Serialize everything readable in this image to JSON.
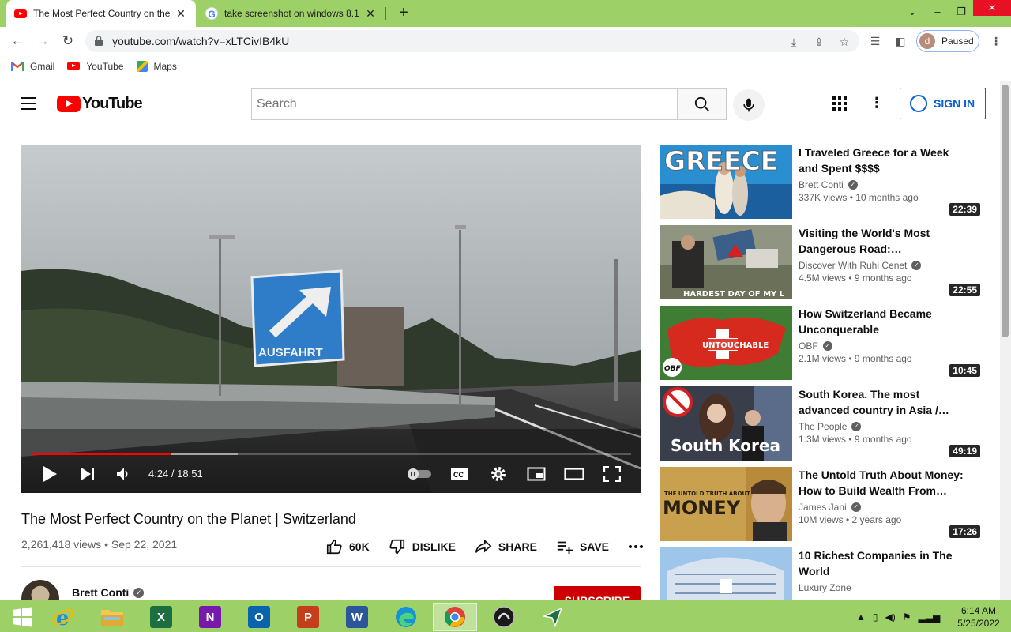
{
  "browser": {
    "tabs": [
      {
        "title": "The Most Perfect Country on the",
        "active": true
      },
      {
        "title": "take screenshot on windows 8.1",
        "active": false
      }
    ],
    "url": "youtube.com/watch?v=xLTCivIB4kU",
    "profile_initial": "d",
    "profile_status": "Paused",
    "bookmarks": [
      "Gmail",
      "YouTube",
      "Maps"
    ]
  },
  "youtube": {
    "logo_text": "YouTube",
    "search_placeholder": "Search",
    "sign_in_label": "SIGN IN"
  },
  "player": {
    "sign_text": "AUSFAHRT",
    "current_time": "4:24",
    "duration": "18:51",
    "time_display": "4:24 / 18:51",
    "progress_fraction": 0.234,
    "buffered_fraction": 0.345
  },
  "video": {
    "title": "The Most Perfect Country on the Planet | Switzerland",
    "stats": "2,261,418 views • Sep 22, 2021",
    "likes": "60K",
    "dislike_label": "DISLIKE",
    "share_label": "SHARE",
    "save_label": "SAVE",
    "channel": "Brett Conti",
    "subscribe_label": "SUBSCRIBE"
  },
  "recommendations": [
    {
      "title": "I Traveled Greece for a Week and Spent $$$$",
      "channel": "Brett Conti",
      "meta": "337K views • 10 months ago",
      "duration": "22:39",
      "thumb_text": "GREECE"
    },
    {
      "title": "Visiting the World's Most Dangerous Road: “Karakoram…",
      "channel": "Discover With Ruhi Cenet",
      "meta": "4.5M views • 9 months ago",
      "duration": "22:55",
      "thumb_text": "HARDEST DAY OF MY L"
    },
    {
      "title": "How Switzerland Became Unconquerable",
      "channel": "OBF",
      "meta": "2.1M views • 9 months ago",
      "duration": "10:45",
      "thumb_text": "UNTOUCHABLE",
      "thumb_badge": "OBF"
    },
    {
      "title": "South Korea. The most advanced country in Asia / Ho…",
      "channel": "The People",
      "meta": "1.3M views • 9 months ago",
      "duration": "49:19",
      "thumb_text": "South Korea"
    },
    {
      "title": "The Untold Truth About Money: How to Build Wealth From…",
      "channel": "James Jani",
      "meta": "10M views • 2 years ago",
      "duration": "17:26",
      "thumb_text": "MONEY",
      "thumb_sub": "THE UNTOLD TRUTH ABOUT"
    },
    {
      "title": "10 Richest Companies in The World",
      "channel": "Luxury Zone",
      "meta": "",
      "duration": "",
      "thumb_text": ""
    }
  ],
  "taskbar": {
    "time": "6:14 AM",
    "date": "5/25/2022",
    "apps": [
      "start",
      "internet-explorer",
      "file-explorer",
      "excel",
      "onenote",
      "outlook",
      "powerpoint",
      "word",
      "edge",
      "chrome",
      "app",
      "send"
    ]
  },
  "colors": {
    "chrome_frame": "#9dd167",
    "youtube_red": "#ff0000",
    "link_blue": "#065fd4"
  }
}
